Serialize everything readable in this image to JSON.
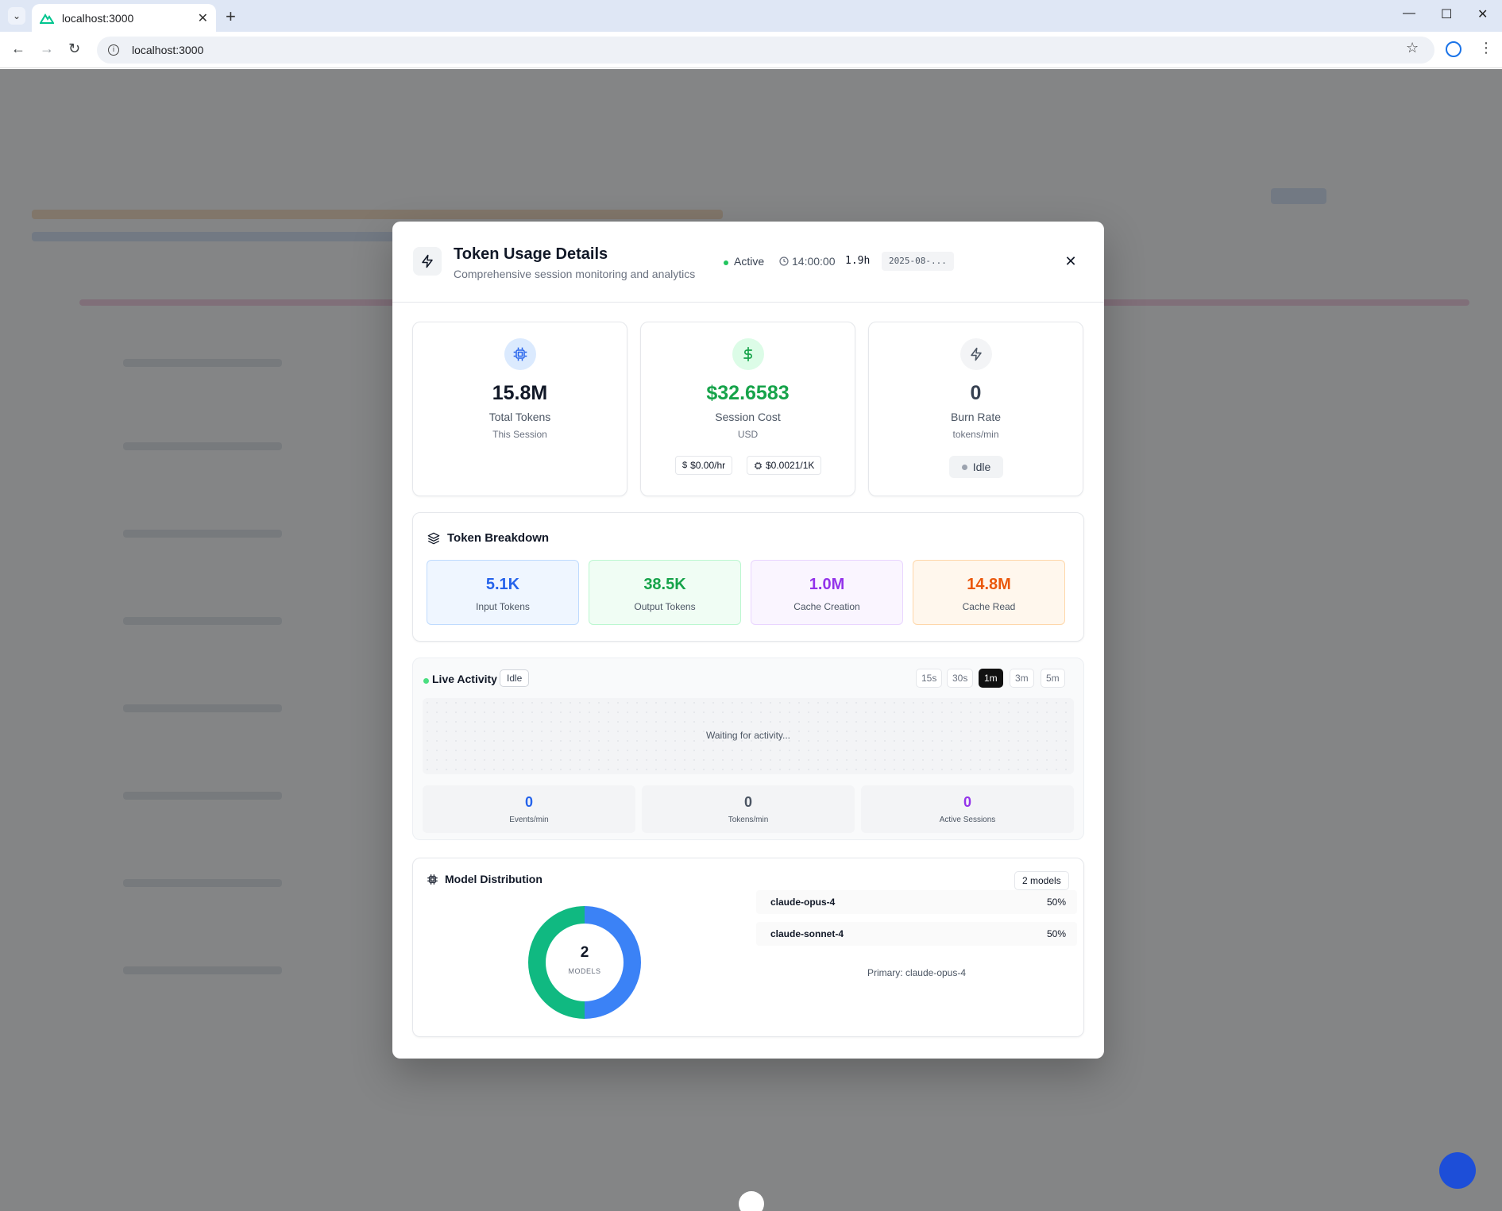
{
  "browser": {
    "tab_title": "localhost:3000",
    "url": "localhost:3000"
  },
  "modal": {
    "title": "Token Usage Details",
    "subtitle": "Comprehensive session monitoring and analytics",
    "status": "Active",
    "start_time": "14:00:00",
    "duration": "1.9h",
    "date": "2025-08-...",
    "stats": {
      "total_tokens": {
        "value": "15.8M",
        "label": "Total Tokens",
        "sub": "This Session",
        "icon": "cpu-icon",
        "color": "#2563eb"
      },
      "session_cost": {
        "value": "$32.6583",
        "label": "Session Cost",
        "sub": "USD",
        "icon": "dollar-icon",
        "color": "#16a34a",
        "per_hour": "$0.00/hr",
        "per_1k": "$0.0021/1K"
      },
      "burn_rate": {
        "value": "0",
        "label": "Burn Rate",
        "sub": "tokens/min",
        "icon": "zap-icon",
        "color": "#374151",
        "state": "Idle"
      }
    },
    "breakdown": {
      "title": "Token Breakdown",
      "items": [
        {
          "value": "5.1K",
          "label": "Input Tokens",
          "color": "#2563eb",
          "bg": "#eff6ff",
          "border": "#bfdbfe"
        },
        {
          "value": "38.5K",
          "label": "Output Tokens",
          "color": "#16a34a",
          "bg": "#f0fdf4",
          "border": "#bbf7d0"
        },
        {
          "value": "1.0M",
          "label": "Cache Creation",
          "color": "#9333ea",
          "bg": "#faf5ff",
          "border": "#e9d5ff"
        },
        {
          "value": "14.8M",
          "label": "Cache Read",
          "color": "#ea580c",
          "bg": "#fff7ed",
          "border": "#fed7aa"
        }
      ]
    },
    "live": {
      "title": "Live Activity",
      "state": "Idle",
      "ranges": [
        "15s",
        "30s",
        "1m",
        "3m",
        "5m"
      ],
      "active_range": "1m",
      "waiting_text": "Waiting for activity...",
      "stats": [
        {
          "value": "0",
          "label": "Events/min",
          "color": "#2563eb"
        },
        {
          "value": "0",
          "label": "Tokens/min",
          "color": "#4b5563"
        },
        {
          "value": "0",
          "label": "Active Sessions",
          "color": "#9333ea"
        }
      ]
    },
    "models": {
      "title": "Model Distribution",
      "count_label": "2 models",
      "center_value": "2",
      "center_label": "MODELS",
      "list": [
        {
          "name": "claude-opus-4",
          "pct": "50%",
          "share": 0.5,
          "color": "#3b82f6"
        },
        {
          "name": "claude-sonnet-4",
          "pct": "50%",
          "share": 0.5,
          "color": "#10b981"
        }
      ],
      "primary": "Primary: claude-opus-4"
    }
  }
}
